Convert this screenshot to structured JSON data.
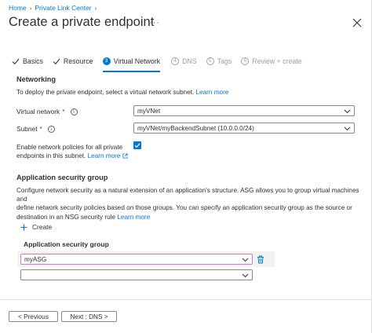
{
  "breadcrumb": [
    {
      "label": "Home"
    },
    {
      "label": "Private Link Center"
    }
  ],
  "title": "Create a private endpoint",
  "title_menu": "···",
  "tabs": [
    {
      "label": "Basics",
      "state": "complete",
      "icon": "checkmark-icon"
    },
    {
      "label": "Resource",
      "state": "complete",
      "icon": "checkmark-icon"
    },
    {
      "label": "Virtual Network",
      "state": "active",
      "step": "3"
    },
    {
      "label": "DNS",
      "state": "inactive",
      "step": "4"
    },
    {
      "label": "Tags",
      "state": "inactive",
      "step": "5"
    },
    {
      "label": "Review + create",
      "state": "inactive",
      "step": "6"
    }
  ],
  "networking": {
    "title": "Networking",
    "description": "To deploy the private endpoint, select a virtual network subnet.",
    "learn_more": "Learn more",
    "virtual_network_label": "Virtual network",
    "virtual_network_value": "myVNet",
    "subnet_label": "Subnet",
    "subnet_value": "myVNet/myBackendSubnet (10.0.0.0/24)",
    "required_marker": "*",
    "network_policies_label_1": "Enable network policies for all private",
    "network_policies_label_2": "endpoints in this subnet.",
    "network_policies_learn_more": "Learn more",
    "network_policies_checked": true
  },
  "asg": {
    "title": "Application security group",
    "description_1": "Configure network security as a natural extension of an application's structure. ASG allows you to group virtual machines and",
    "description_2": "define network security policies based on those groups. You can specify an application security group as the source or",
    "description_3": "destination in an NSG security rule",
    "learn_more": "Learn more",
    "create_label": "Create",
    "column_header": "Application security group",
    "rows": [
      {
        "value": "myASG"
      },
      {
        "value": ""
      }
    ]
  },
  "footer": {
    "previous_label": "< Previous",
    "next_label": "Next : DNS >"
  },
  "colors": {
    "accent": "#0078d4",
    "required": "#a4262c",
    "active_outline": "#c77dd6"
  }
}
